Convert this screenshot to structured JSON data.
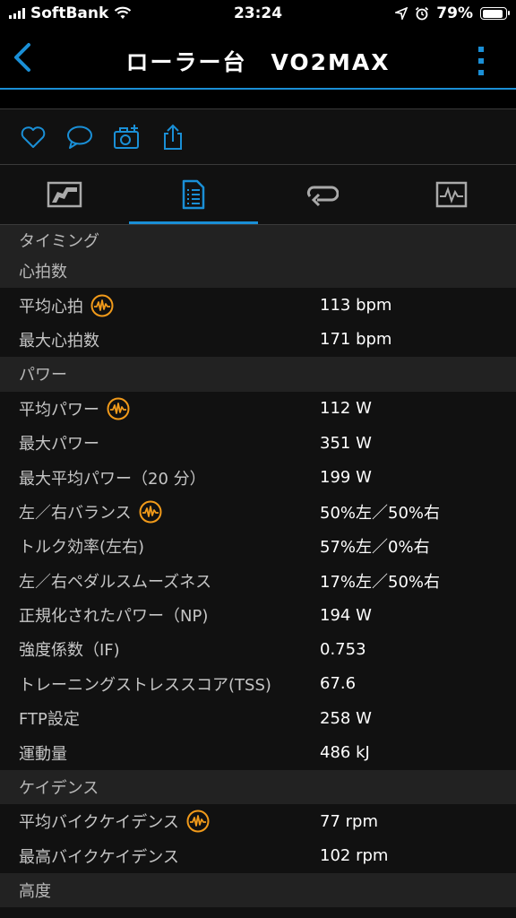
{
  "status": {
    "carrier": "SoftBank",
    "time": "23:24",
    "battery": "79%",
    "battery_level": 0.79,
    "icons": [
      "signal-icon",
      "wifi-icon",
      "location-arrow-icon",
      "alarm-icon",
      "battery-icon"
    ]
  },
  "nav": {
    "title": "ローラー台　VO2MAX",
    "back_icon": "chevron-left-icon",
    "more_icon": "more-vertical-icon"
  },
  "actions": [
    "heart-icon",
    "comment-icon",
    "add-photo-icon",
    "share-icon"
  ],
  "tabs": [
    {
      "icon": "summary-icon",
      "active": false
    },
    {
      "icon": "stats-icon",
      "active": true
    },
    {
      "icon": "laps-icon",
      "active": false
    },
    {
      "icon": "charts-icon",
      "active": false
    }
  ],
  "colors": {
    "accent_blue": "#1a8fd6",
    "accent_orange": "#f19a1a",
    "section_bg": "#222222",
    "row_bg": "#111111"
  },
  "sections": {
    "timing": "タイミング",
    "heart_rate": "心拍数",
    "power": "パワー",
    "cadence": "ケイデンス",
    "altitude": "高度"
  },
  "heart_rate_rows": [
    {
      "label": "平均心拍",
      "value": "113 bpm",
      "badge": true
    },
    {
      "label": "最大心拍数",
      "value": "171 bpm",
      "badge": false
    }
  ],
  "power_rows": [
    {
      "label": "平均パワー",
      "value": "112 W",
      "badge": true
    },
    {
      "label": "最大パワー",
      "value": "351 W",
      "badge": false
    },
    {
      "label": "最大平均パワー（20 分）",
      "value": "199 W",
      "badge": false
    },
    {
      "label": "左／右バランス",
      "value": "50%左／50%右",
      "badge": true
    },
    {
      "label": "トルク効率(左右)",
      "value": "57%左／0%右",
      "badge": false
    },
    {
      "label": "左／右ペダルスムーズネス",
      "value": "17%左／50%右",
      "badge": false
    },
    {
      "label": "正規化されたパワー（NP)",
      "value": "194 W",
      "badge": false
    },
    {
      "label": "強度係数（IF)",
      "value": "0.753",
      "badge": false
    },
    {
      "label": "トレーニングストレススコア(TSS)",
      "value": "67.6",
      "badge": false
    },
    {
      "label": "FTP設定",
      "value": "258 W",
      "badge": false
    },
    {
      "label": "運動量",
      "value": "486 kJ",
      "badge": false
    }
  ],
  "cadence_rows": [
    {
      "label": "平均バイクケイデンス",
      "value": "77 rpm",
      "badge": true
    },
    {
      "label": "最高バイクケイデンス",
      "value": "102 rpm",
      "badge": false
    }
  ]
}
